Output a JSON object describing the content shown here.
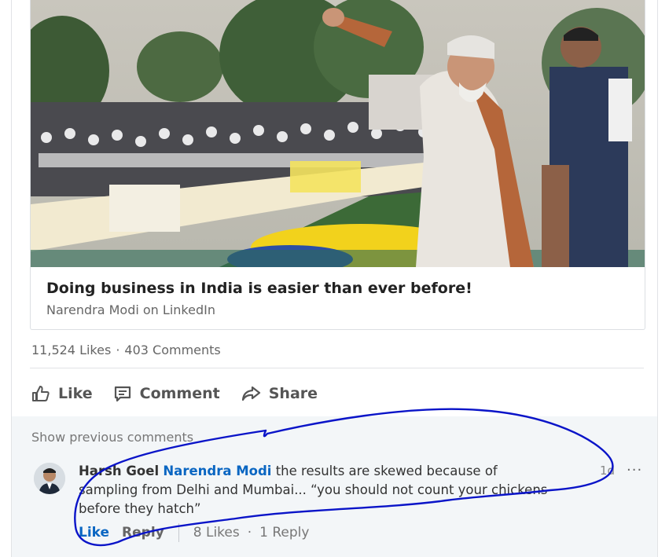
{
  "article": {
    "title": "Doing business in India is easier than ever before!",
    "source": "Narendra Modi on LinkedIn"
  },
  "counts": {
    "likes": "11,524 Likes",
    "separator": "·",
    "comments": "403 Comments"
  },
  "actions": {
    "like": "Like",
    "comment": "Comment",
    "share": "Share"
  },
  "comments_section": {
    "show_previous": "Show previous comments",
    "comment": {
      "author": "Harsh Goel",
      "mention": "Narendra Modi",
      "text": "the results are skewed because of sampling from Delhi and Mumbai... “you should not count your chickens before they hatch”",
      "time": "1d",
      "more": "···",
      "like": "Like",
      "reply": "Reply",
      "likes_count": "8 Likes",
      "separator": "·",
      "replies_count": "1 Reply"
    }
  },
  "colors": {
    "link_blue": "#0a66c2",
    "annotation_blue": "#0a14c8",
    "comments_bg": "#f3f6f8"
  },
  "icons": [
    "thumbs-up-icon",
    "comment-icon",
    "share-arrow-icon",
    "more-dots-icon"
  ]
}
